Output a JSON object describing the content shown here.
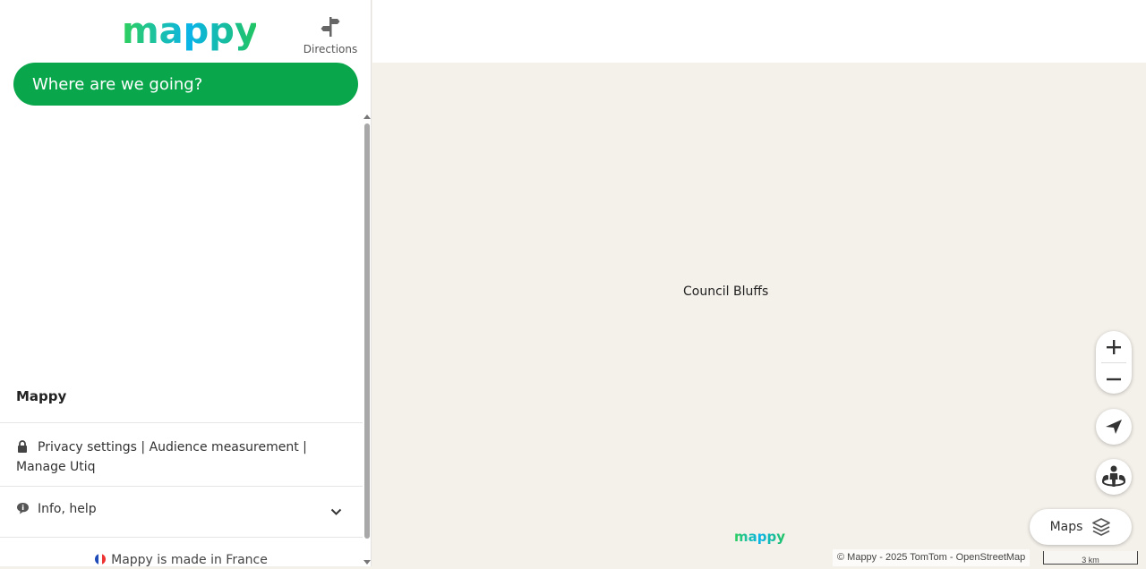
{
  "brand": {
    "logo_text": "mappy",
    "logo_colors": [
      "#2fcf5b",
      "#00b0f0",
      "#9fdc1f"
    ]
  },
  "header": {
    "directions_label": "Directions"
  },
  "search": {
    "label": "Where are we going?",
    "bg_color": "#0aa64b"
  },
  "sidebar": {
    "section_title": "Mappy",
    "privacy_text": "Privacy settings | Audience measurement | Manage Utiq",
    "info_label": "Info, help",
    "made_in": "Mappy is made in France"
  },
  "map": {
    "city_label": "Council Bluffs",
    "maps_button_label": "Maps",
    "attribution": "© Mappy - 2025 TomTom - OpenStreetMap",
    "scale_label": "3 km",
    "watermark_text": "mappy",
    "controls": [
      "zoom-in-icon",
      "zoom-out-icon",
      "locate-icon",
      "street-view-icon",
      "layers-icon"
    ]
  }
}
